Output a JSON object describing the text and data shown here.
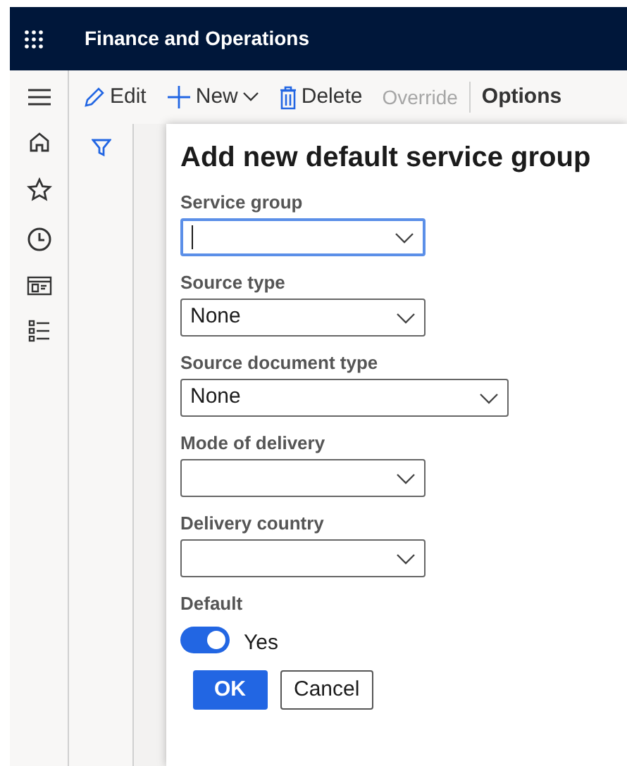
{
  "app": {
    "title": "Finance and Operations"
  },
  "toolbar": [
    {
      "kind": "edit",
      "label": "Edit",
      "disabled": false
    },
    {
      "kind": "new",
      "label": "New",
      "disabled": false
    },
    {
      "kind": "delete",
      "label": "Delete",
      "disabled": false
    },
    {
      "kind": "plain",
      "label": "Override",
      "disabled": true
    },
    {
      "kind": "menu",
      "label": "Options",
      "disabled": false
    }
  ],
  "dialog": {
    "title": "Add new default service group",
    "fields": [
      {
        "label": "Service group",
        "focused": true
      },
      {
        "label": "Source type",
        "value": "None",
        "focused": false
      },
      {
        "label": "Source document type",
        "value": "None",
        "focused": false
      },
      {
        "label": "Mode of delivery",
        "focused": false
      },
      {
        "label": "Delivery country",
        "focused": false
      }
    ],
    "toggle": {
      "label": "Default",
      "on": true,
      "text": "Yes"
    },
    "buttons": [
      {
        "label": "OK",
        "primary": true
      },
      {
        "label": "Cancel",
        "primary": false
      }
    ]
  }
}
